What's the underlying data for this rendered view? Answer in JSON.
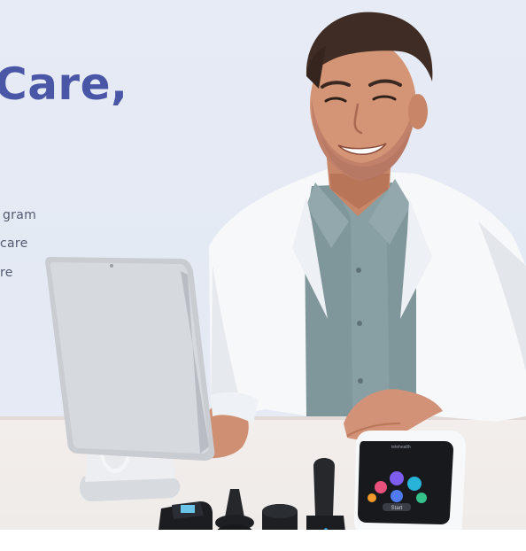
{
  "hero": {
    "headline": "Care,",
    "bullets": [
      "gram",
      "care",
      "re"
    ]
  },
  "device": {
    "brand": "telehealth",
    "cta": "Start"
  },
  "colors": {
    "headline": "#4a56a6",
    "background": "#e6ebf5",
    "coat": "#f7f8fa",
    "shirt": "#7f969a",
    "desk": "#efebe9"
  },
  "images": {
    "doctor": "doctor-photo",
    "tablet": "tablet-on-stand",
    "accessories": [
      "pulse-oximeter",
      "otoscope-tip",
      "stethoscope-tip",
      "thermometer-tip"
    ],
    "device": "handheld-exam-device"
  }
}
